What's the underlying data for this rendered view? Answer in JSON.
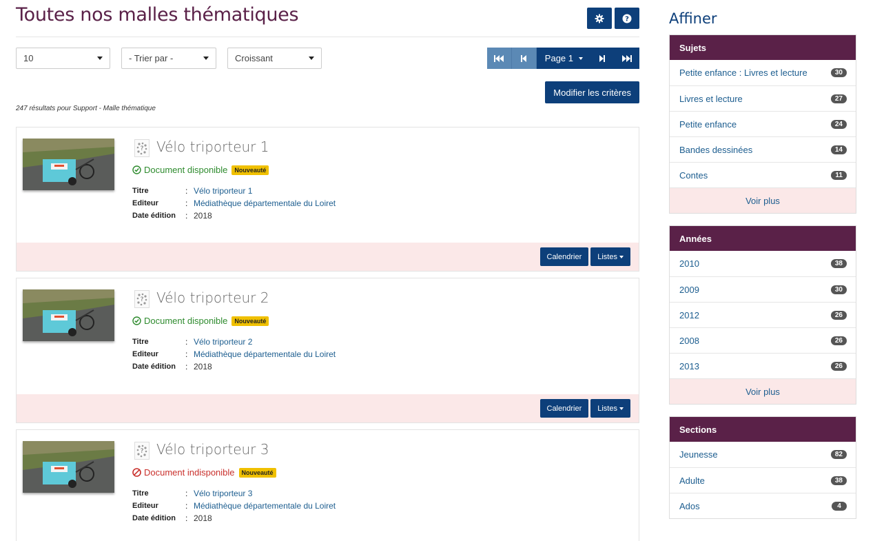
{
  "page": {
    "title": "Toutes nos malles thématiques",
    "settings_icon": "gear-icon",
    "help_icon": "question-circle-icon"
  },
  "controls": {
    "per_page": "10",
    "sort_by": "- Trier par -",
    "order": "Croissant",
    "pager_page": "Page 1",
    "modify_button": "Modifier les critères",
    "results_summary": "247 résultats pour Support - Malle thématique"
  },
  "results": [
    {
      "title": "Vélo triporteur 1",
      "status": "Document disponible",
      "available": true,
      "badge": "Nouveauté",
      "fields": [
        {
          "label": "Titre",
          "value": "Vélo triporteur 1",
          "link": true
        },
        {
          "label": "Editeur",
          "value": "Médiathèque départementale du Loiret",
          "link": true
        },
        {
          "label": "Date édition",
          "value": "2018",
          "link": false
        }
      ],
      "actions": {
        "calendar": "Calendrier",
        "lists": "Listes"
      }
    },
    {
      "title": "Vélo triporteur 2",
      "status": "Document disponible",
      "available": true,
      "badge": "Nouveauté",
      "fields": [
        {
          "label": "Titre",
          "value": "Vélo triporteur 2",
          "link": true
        },
        {
          "label": "Editeur",
          "value": "Médiathèque départementale du Loiret",
          "link": true
        },
        {
          "label": "Date édition",
          "value": "2018",
          "link": false
        }
      ],
      "actions": {
        "calendar": "Calendrier",
        "lists": "Listes"
      }
    },
    {
      "title": "Vélo triporteur 3",
      "status": "Document indisponible",
      "available": false,
      "badge": "Nouveauté",
      "fields": [
        {
          "label": "Titre",
          "value": "Vélo triporteur 3",
          "link": true
        },
        {
          "label": "Editeur",
          "value": "Médiathèque départementale du Loiret",
          "link": true
        },
        {
          "label": "Date édition",
          "value": "2018",
          "link": false
        }
      ]
    }
  ],
  "sidebar": {
    "title": "Affiner",
    "facets": [
      {
        "header": "Sujets",
        "items": [
          {
            "label": "Petite enfance : Livres et lecture",
            "count": "30"
          },
          {
            "label": "Livres et lecture",
            "count": "27"
          },
          {
            "label": "Petite enfance",
            "count": "24"
          },
          {
            "label": "Bandes dessinées",
            "count": "14"
          },
          {
            "label": "Contes",
            "count": "11"
          }
        ],
        "more": "Voir plus"
      },
      {
        "header": "Années",
        "items": [
          {
            "label": "2010",
            "count": "38"
          },
          {
            "label": "2009",
            "count": "30"
          },
          {
            "label": "2012",
            "count": "26"
          },
          {
            "label": "2008",
            "count": "26"
          },
          {
            "label": "2013",
            "count": "26"
          }
        ],
        "more": "Voir plus"
      },
      {
        "header": "Sections",
        "items": [
          {
            "label": "Jeunesse",
            "count": "82"
          },
          {
            "label": "Adulte",
            "count": "38"
          },
          {
            "label": "Ados",
            "count": "4"
          }
        ]
      }
    ]
  },
  "colors": {
    "brand_purple": "#5a2148",
    "primary_blue": "#0d3f7a",
    "link_blue": "#1c5d8f",
    "available_green": "#2e8b2e",
    "unavailable_red": "#c9302c",
    "new_badge": "#f0c000",
    "footer_pink": "#fbe8e8"
  }
}
